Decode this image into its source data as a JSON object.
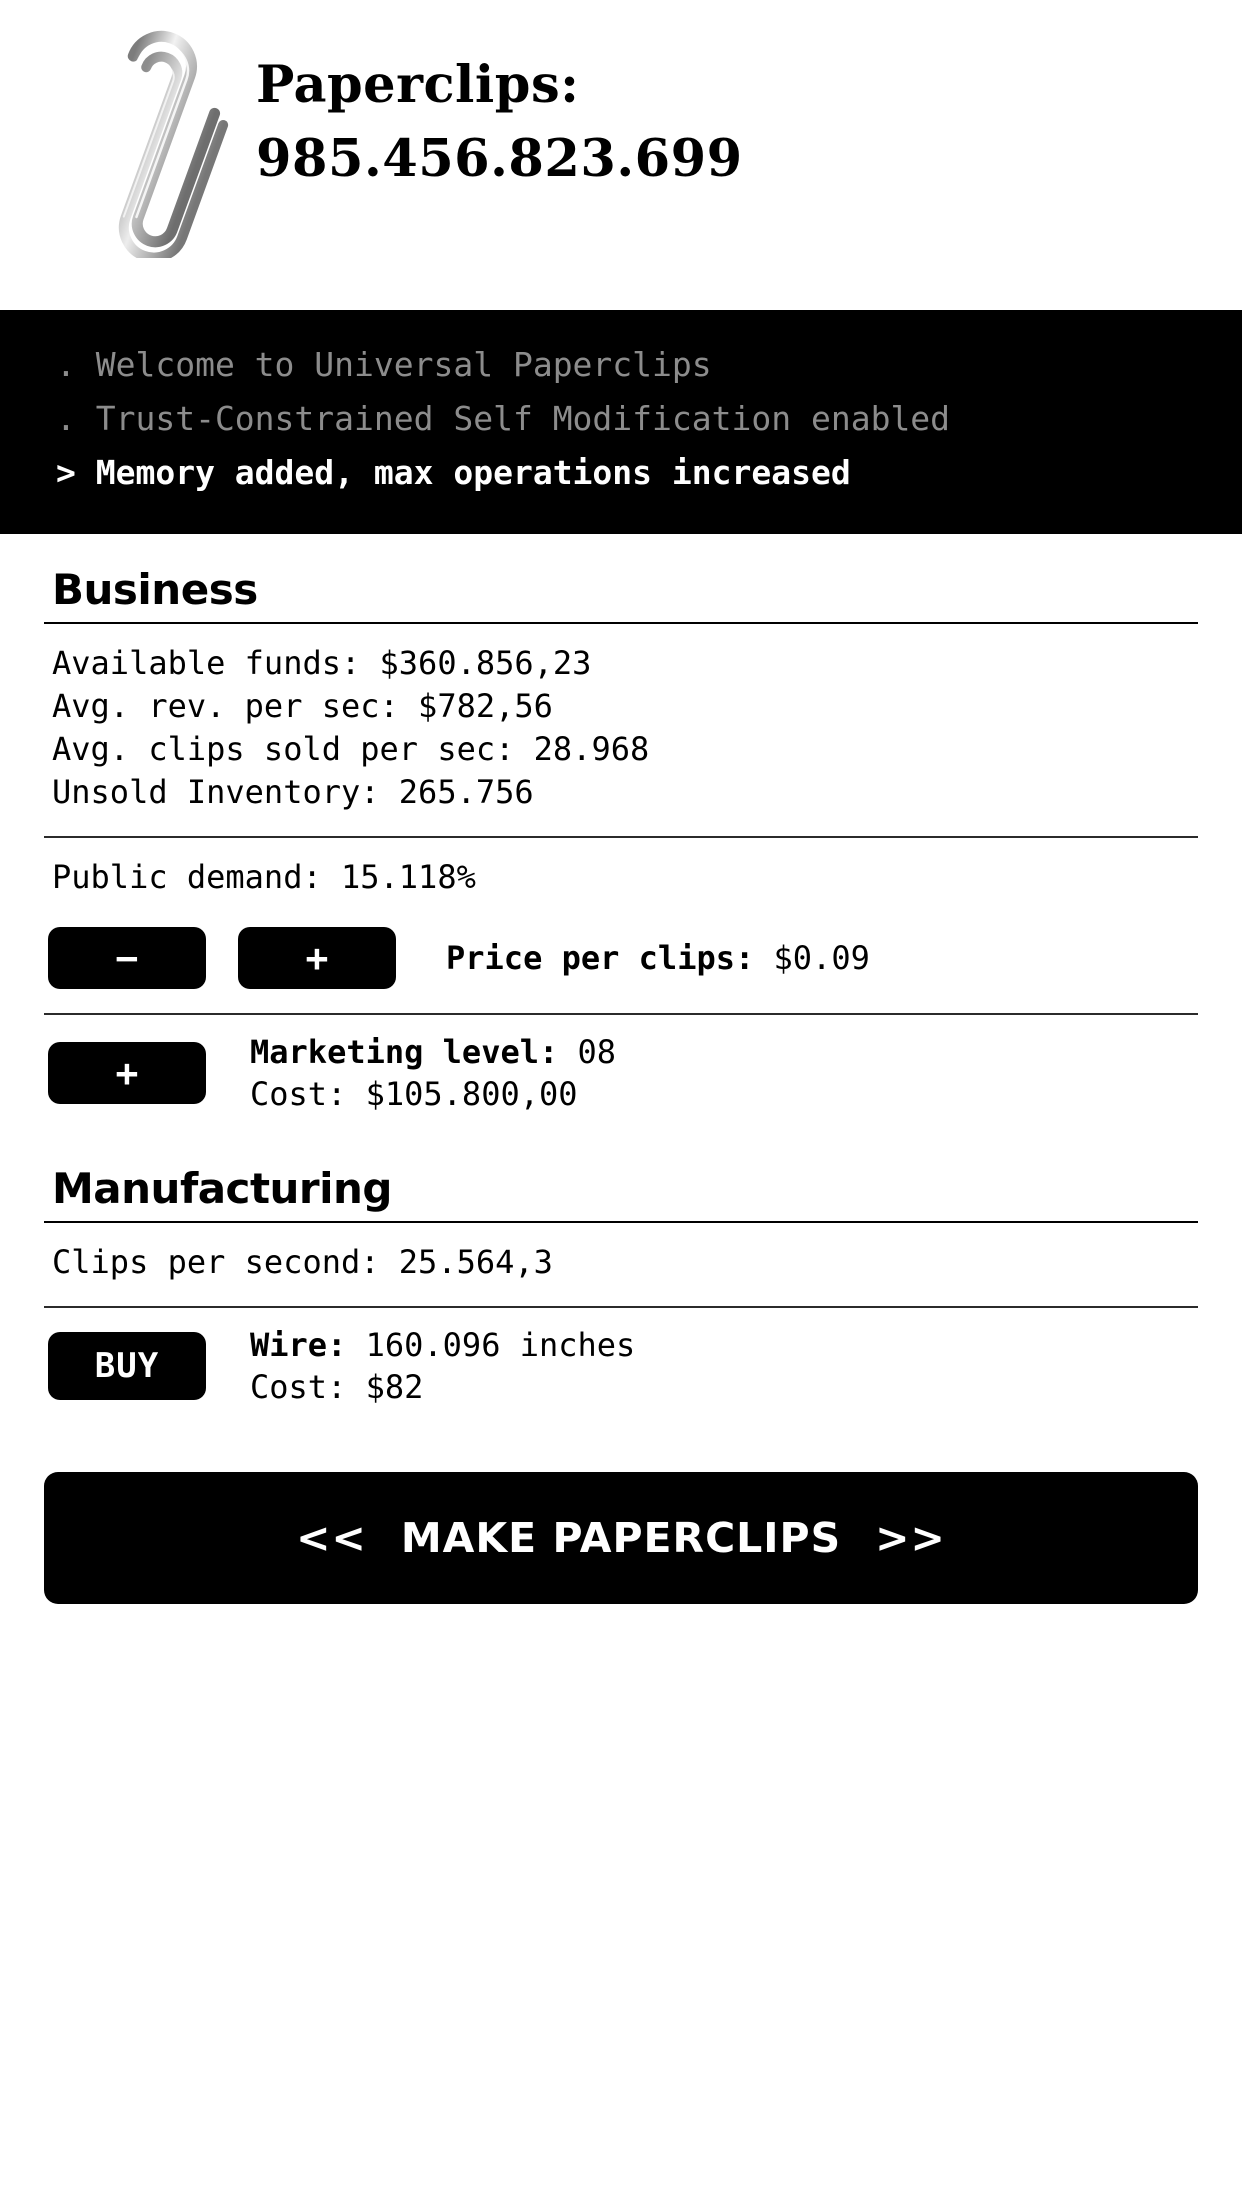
{
  "header": {
    "clip_icon": "paperclip-image",
    "title_label": "Paperclips:",
    "clip_count": "985.456.823.699"
  },
  "log": {
    "lines": [
      ". Welcome to Universal Paperclips",
      ". Trust-Constrained Self Modification enabled",
      "> Memory added, max operations increased"
    ]
  },
  "business": {
    "title": "Business",
    "stats": [
      "Available funds: $360.856,23",
      "Avg. rev. per sec: $782,56",
      "Avg. clips sold per sec: 28.968",
      "Unsold Inventory: 265.756"
    ],
    "public_demand": "Public demand: 15.118%",
    "price": {
      "lower_label": "−",
      "raise_label": "+",
      "label": "Price per clips:",
      "value": "$0.09"
    },
    "marketing": {
      "buy_label": "+",
      "level_label": "Marketing level:",
      "level_value": "08",
      "cost_line": "Cost: $105.800,00"
    }
  },
  "manufacturing": {
    "title": "Manufacturing",
    "clips_per_second": "Clips per second: 25.564,3",
    "wire": {
      "buy_label": "BUY",
      "label": "Wire:",
      "value": "160.096 inches",
      "cost_line": "Cost: $82"
    }
  },
  "make_button": {
    "left_arrow": "<<",
    "label": "MAKE PAPERCLIPS",
    "right_arrow": ">>"
  },
  "colors": {
    "background": "#ffffff",
    "foreground": "#000000",
    "log_background": "#000000",
    "log_old_text": "#8c8c8c",
    "log_new_text": "#ffffff"
  }
}
